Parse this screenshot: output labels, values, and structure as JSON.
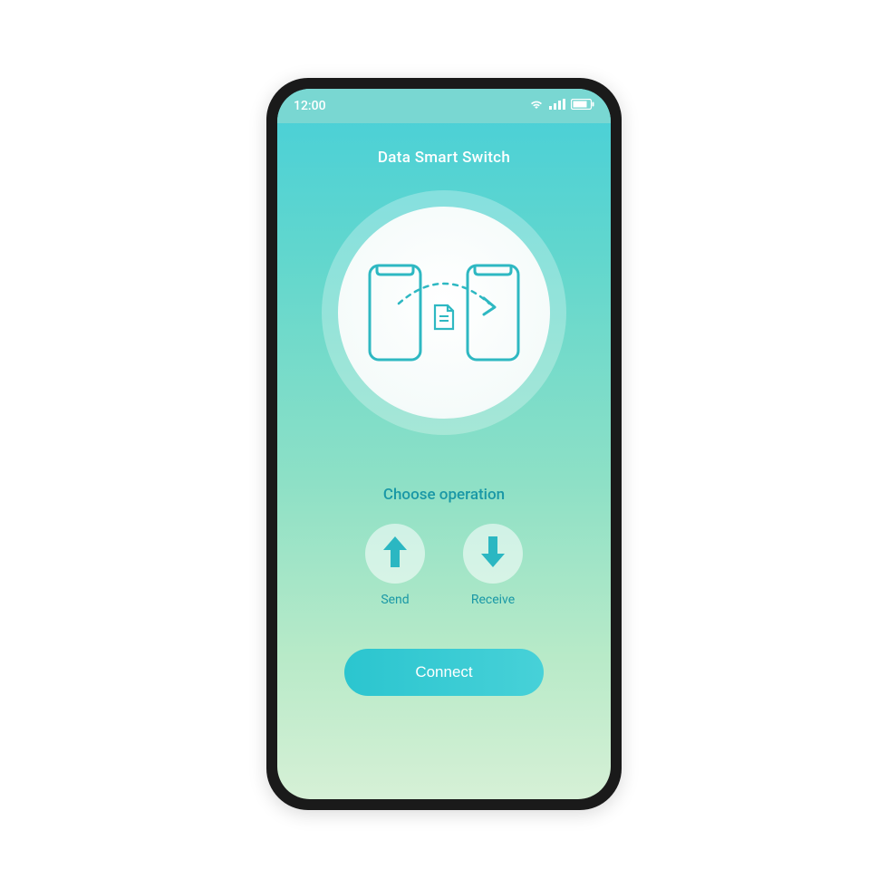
{
  "status_bar": {
    "time": "12:00",
    "icons": {
      "wifi": "wifi-icon",
      "signal": "signal-icon",
      "battery": "battery-icon"
    }
  },
  "app": {
    "title": "Data Smart Switch"
  },
  "hero": {
    "icon": "phone-transfer-icon"
  },
  "operations": {
    "title": "Choose operation",
    "items": [
      {
        "label": "Send",
        "icon": "arrow-up-icon"
      },
      {
        "label": "Receive",
        "icon": "arrow-down-icon"
      }
    ]
  },
  "cta": {
    "label": "Connect"
  },
  "colors": {
    "accent": "#2bc5cf",
    "text_teal": "#1a98a6",
    "icon_teal": "#2eb8c2"
  }
}
